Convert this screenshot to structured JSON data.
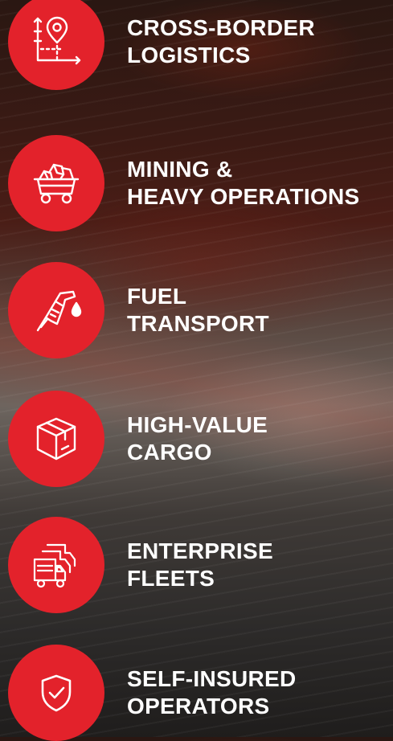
{
  "accent_color": "#e3222b",
  "items": [
    {
      "icon": "map-pin-chart-icon",
      "line1": "CROSS-BORDER",
      "line2": "LOGISTICS"
    },
    {
      "icon": "mine-cart-icon",
      "line1": "MINING &",
      "line2": "HEAVY OPERATIONS"
    },
    {
      "icon": "fuel-nozzle-icon",
      "line1": "FUEL",
      "line2": "TRANSPORT"
    },
    {
      "icon": "package-box-icon",
      "line1": "HIGH-VALUE",
      "line2": "CARGO"
    },
    {
      "icon": "truck-fleet-icon",
      "line1": "ENTERPRISE",
      "line2": "FLEETS"
    },
    {
      "icon": "shield-check-icon",
      "line1": "SELF-INSURED",
      "line2": "OPERATORS"
    }
  ]
}
